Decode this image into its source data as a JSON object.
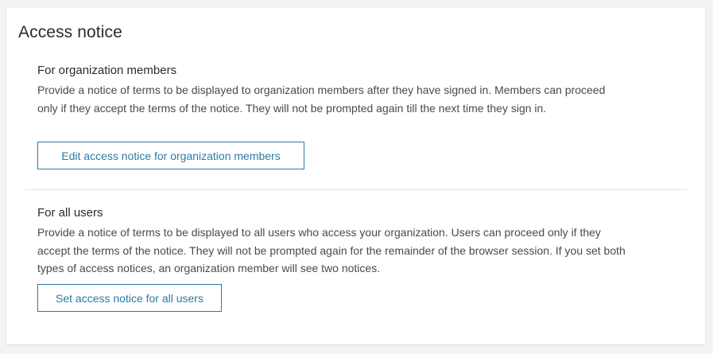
{
  "page": {
    "title": "Access notice"
  },
  "members": {
    "heading": "For organization members",
    "description": "Provide a notice of terms to be displayed to organization members after they have signed in. Members can proceed only if they accept the terms of the notice. They will not be prompted again till the next time they sign in.",
    "button_label": "Edit access notice for organization members"
  },
  "all_users": {
    "heading": "For all users",
    "description": "Provide a notice of terms to be displayed to all users who access your organization. Users can proceed only if they accept the terms of the notice. They will not be prompted again for the remainder of the browser session. If you set both types of access notices, an organization member will see two notices.",
    "button_label": "Set access notice for all users"
  },
  "colors": {
    "accent": "#2b7ba6",
    "background": "#f3f3f3",
    "card": "#ffffff",
    "text": "#4a4a4a"
  }
}
